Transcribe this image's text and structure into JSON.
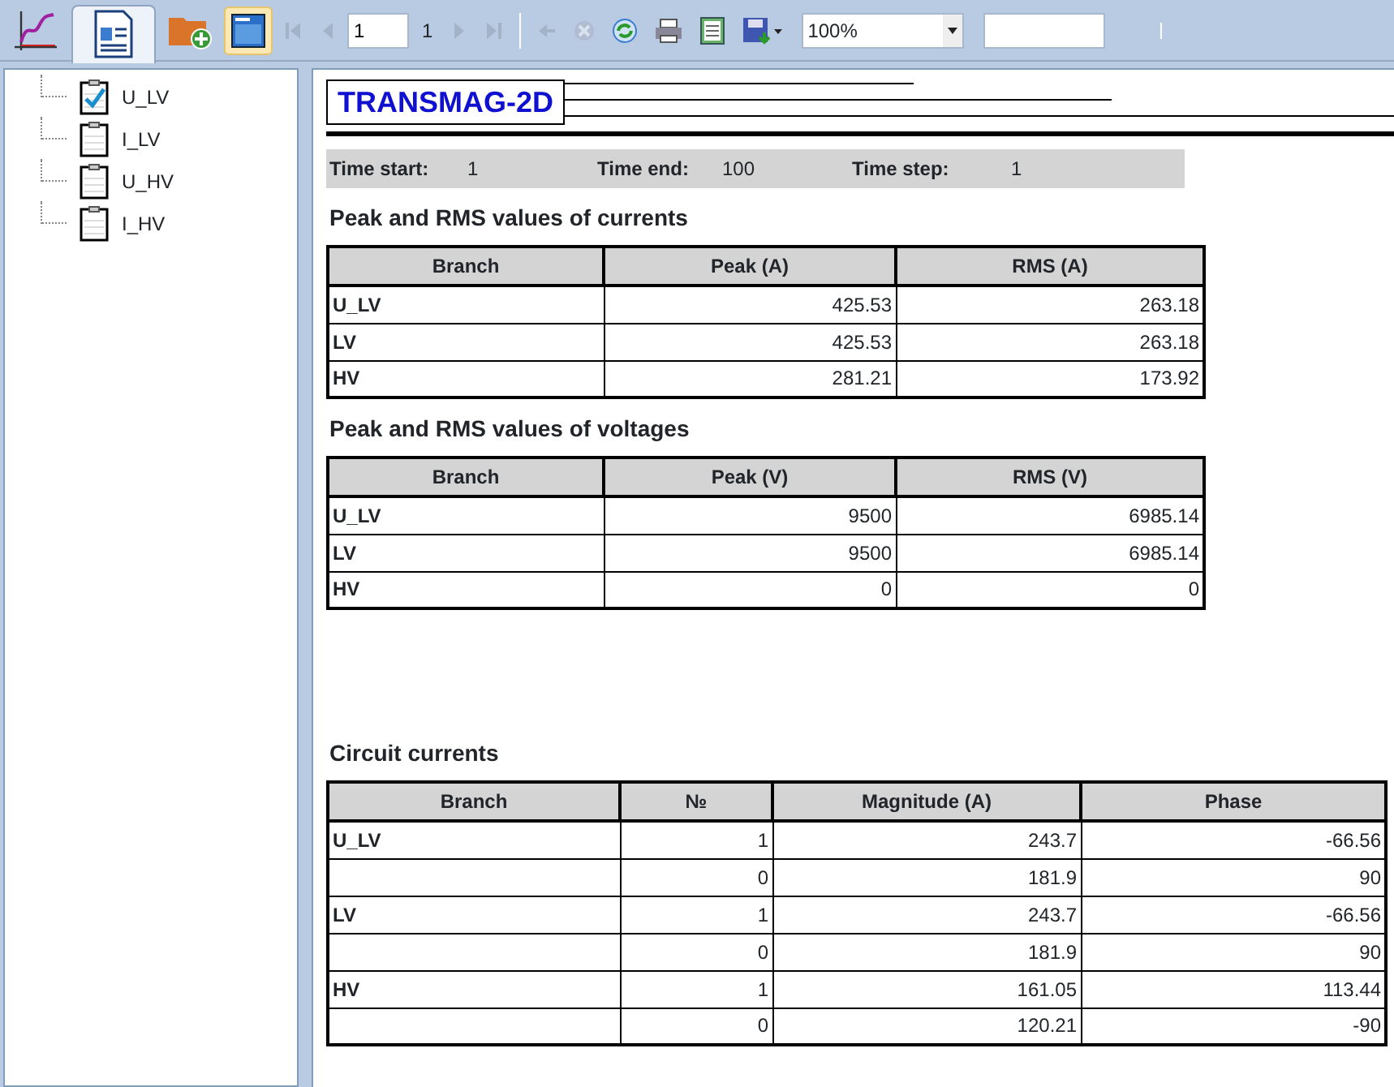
{
  "toolbar": {
    "view_tabs": [
      {
        "kind": "chart",
        "selected": false
      },
      {
        "kind": "report",
        "selected": true
      }
    ],
    "panel_toggle": {
      "on": true
    },
    "page_input": "1",
    "page_count": "1",
    "zoom": "100%"
  },
  "tree": {
    "items": [
      {
        "label": "U_LV",
        "checked": true
      },
      {
        "label": "I_LV",
        "checked": false
      },
      {
        "label": "U_HV",
        "checked": false
      },
      {
        "label": "I_HV",
        "checked": false
      }
    ]
  },
  "report": {
    "title": "TRANSMAG-2D",
    "time_info": [
      {
        "label": "Time start:",
        "value": "1"
      },
      {
        "label": "Time end:",
        "value": "100"
      },
      {
        "label": "Time step:",
        "value": "1"
      }
    ],
    "tables": [
      {
        "title": "Peak and RMS values of currents",
        "columns": [
          "Branch",
          "Peak (A)",
          "RMS (A)"
        ],
        "rows": [
          [
            "U_LV",
            "425.53",
            "263.18"
          ],
          [
            "LV",
            "425.53",
            "263.18"
          ],
          [
            "HV",
            "281.21",
            "173.92"
          ]
        ]
      },
      {
        "title": "Peak and RMS values of voltages",
        "columns": [
          "Branch",
          "Peak (V)",
          "RMS (V)"
        ],
        "rows": [
          [
            "U_LV",
            "9500",
            "6985.14"
          ],
          [
            "LV",
            "9500",
            "6985.14"
          ],
          [
            "HV",
            "0",
            "0"
          ]
        ]
      },
      {
        "title": "Circuit currents",
        "columns": [
          "Branch",
          "№",
          "Magnitude (A)",
          "Phase"
        ],
        "rows": [
          [
            "U_LV",
            "1",
            "243.7",
            "-66.56"
          ],
          [
            null,
            "0",
            "181.9",
            "90"
          ],
          [
            "LV",
            "1",
            "243.7",
            "-66.56"
          ],
          [
            null,
            "0",
            "181.9",
            "90"
          ],
          [
            "HV",
            "1",
            "161.05",
            "113.44"
          ],
          [
            null,
            "0",
            "120.21",
            "-90"
          ]
        ]
      }
    ]
  }
}
